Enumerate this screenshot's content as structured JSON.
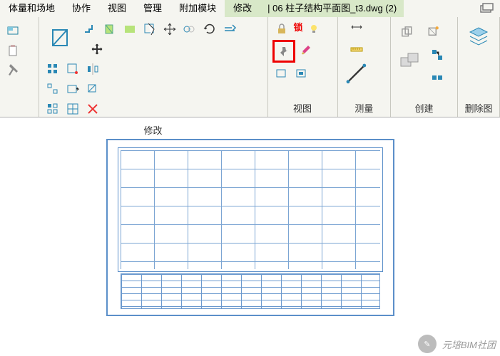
{
  "menu": {
    "mass": "体量和场地",
    "collab": "协作",
    "view": "视图",
    "manage": "管理",
    "addins": "附加模块",
    "modify": "修改"
  },
  "filetab": "| 06 柱子结构平面图_t3.dwg (2)",
  "panels": {
    "modify": "修改",
    "view": "视图",
    "measure": "测量",
    "create": "创建",
    "clip": "删除图"
  },
  "lock_label": "锁",
  "watermark": "元培BIM社团"
}
